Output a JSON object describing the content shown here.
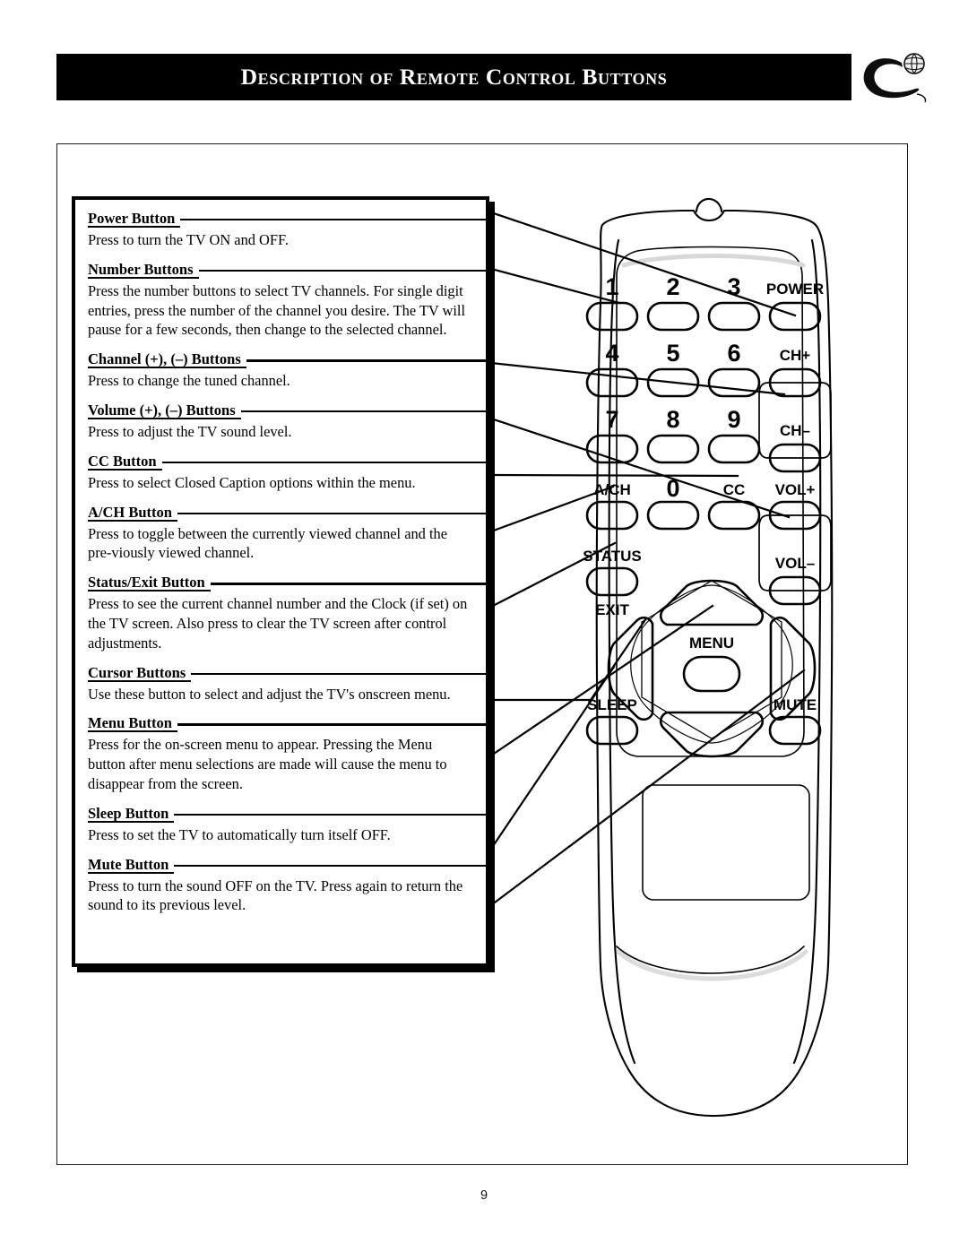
{
  "header": {
    "title": "Description of Remote Control Buttons",
    "logo_icon": "philips-shield-globe-logo-icon"
  },
  "page": {
    "number": "9"
  },
  "descriptions": [
    {
      "id": "power",
      "heading": "Power Button",
      "body": "Press to turn the TV ON and OFF."
    },
    {
      "id": "number",
      "heading": "Number Buttons",
      "body": "Press the number buttons to select TV channels. For single digit entries, press the number of the channel you desire. The TV will pause for a few seconds, then change to the selected channel."
    },
    {
      "id": "channel",
      "heading": "Channel (+), (–) Buttons",
      "body": "Press to change the tuned channel."
    },
    {
      "id": "volume",
      "heading": "Volume (+), (–) Buttons",
      "body": "Press to adjust the TV sound level."
    },
    {
      "id": "cc",
      "heading": "CC Button",
      "body": "Press to select Closed Caption options within the menu."
    },
    {
      "id": "ach",
      "heading": "A/CH Button",
      "body": "Press to toggle between the currently viewed channel and the pre-viously viewed channel."
    },
    {
      "id": "status-exit",
      "heading": "Status/Exit Button",
      "body": "Press to see the current channel number and the Clock (if set) on the TV screen. Also press to clear the TV screen after control adjustments."
    },
    {
      "id": "cursor",
      "heading": "Cursor Buttons",
      "body": "Use these button to select and adjust the TV's onscreen menu."
    },
    {
      "id": "menu",
      "heading": "Menu Button",
      "body": "Press for the on-screen menu to appear. Pressing the Menu button after menu selections are made will cause the menu to disappear from the screen."
    },
    {
      "id": "sleep",
      "heading": "Sleep Button",
      "body": "Press to set the TV to automatically turn itself OFF."
    },
    {
      "id": "mute",
      "heading": "Mute Button",
      "body": "Press to turn the sound OFF on the TV. Press again to return the sound to its previous level."
    }
  ],
  "remote": {
    "keypad_row1": [
      "1",
      "2",
      "3"
    ],
    "keypad_row2": [
      "4",
      "5",
      "6"
    ],
    "keypad_row3": [
      "7",
      "8",
      "9"
    ],
    "keypad_row4": [
      "A/CH",
      "0",
      "CC"
    ],
    "power_label": "POWER",
    "ch_up_label": "CH+",
    "ch_down_label": "CH–",
    "vol_up_label": "VOL+",
    "vol_down_label": "VOL–",
    "status_label": "STATUS",
    "exit_label": "EXIT",
    "menu_label": "MENU",
    "sleep_label": "SLEEP",
    "mute_label": "MUTE"
  },
  "colors": {
    "header_bg": "#000000",
    "header_text": "#ffffff",
    "line": "#000000",
    "page_bg": "#ffffff"
  }
}
